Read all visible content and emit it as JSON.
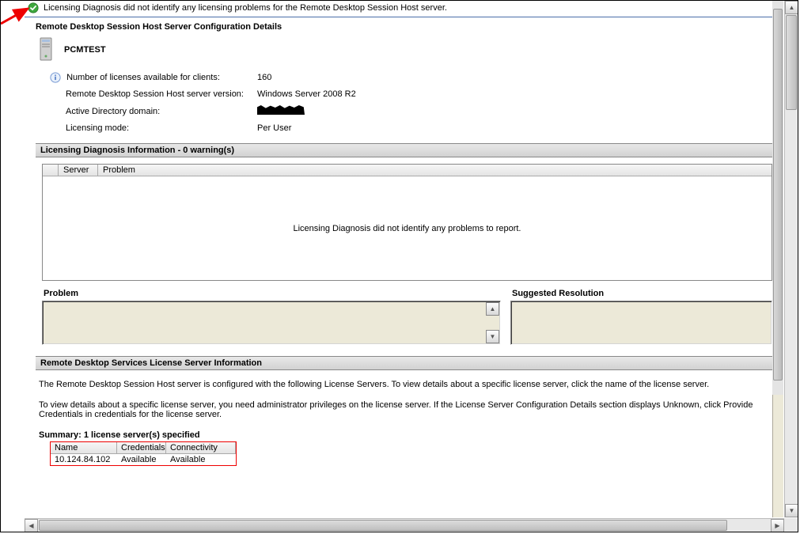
{
  "status_message": "Licensing Diagnosis did not identify any licensing problems for the Remote Desktop Session Host server.",
  "config": {
    "title": "Remote Desktop Session Host Server Configuration Details",
    "server_name": "PCMTEST",
    "rows": [
      {
        "label": "Number of licenses available for clients:",
        "value": "160",
        "info": true
      },
      {
        "label": "Remote Desktop Session Host server version:",
        "value": "Windows Server 2008 R2"
      },
      {
        "label": "Active Directory domain:",
        "value": "__REDACTED__"
      },
      {
        "label": "Licensing mode:",
        "value": "Per User"
      }
    ]
  },
  "diag": {
    "header": "Licensing Diagnosis Information - 0 warning(s)",
    "cols": {
      "server": "Server",
      "problem": "Problem"
    },
    "empty_msg": "Licensing Diagnosis did not identify any problems to report.",
    "problem_label": "Problem",
    "resolution_label": "Suggested Resolution"
  },
  "license": {
    "header": "Remote Desktop Services License Server Information",
    "p1": "The Remote Desktop Session Host server is configured with the following License Servers. To view details about a specific license server, click the name of the license server.",
    "p2": "To view details about a specific license server, you need administrator privileges on the license server. If the License Server Configuration Details section displays Unknown, click Provide Credentials in credentials for the license server.",
    "summary_title": "Summary: 1 license server(s) specified",
    "cols": {
      "name": "Name",
      "cred": "Credentials",
      "conn": "Connectivity"
    },
    "rows": [
      {
        "name": "10.124.84.102",
        "cred": "Available",
        "conn": "Available"
      }
    ]
  }
}
